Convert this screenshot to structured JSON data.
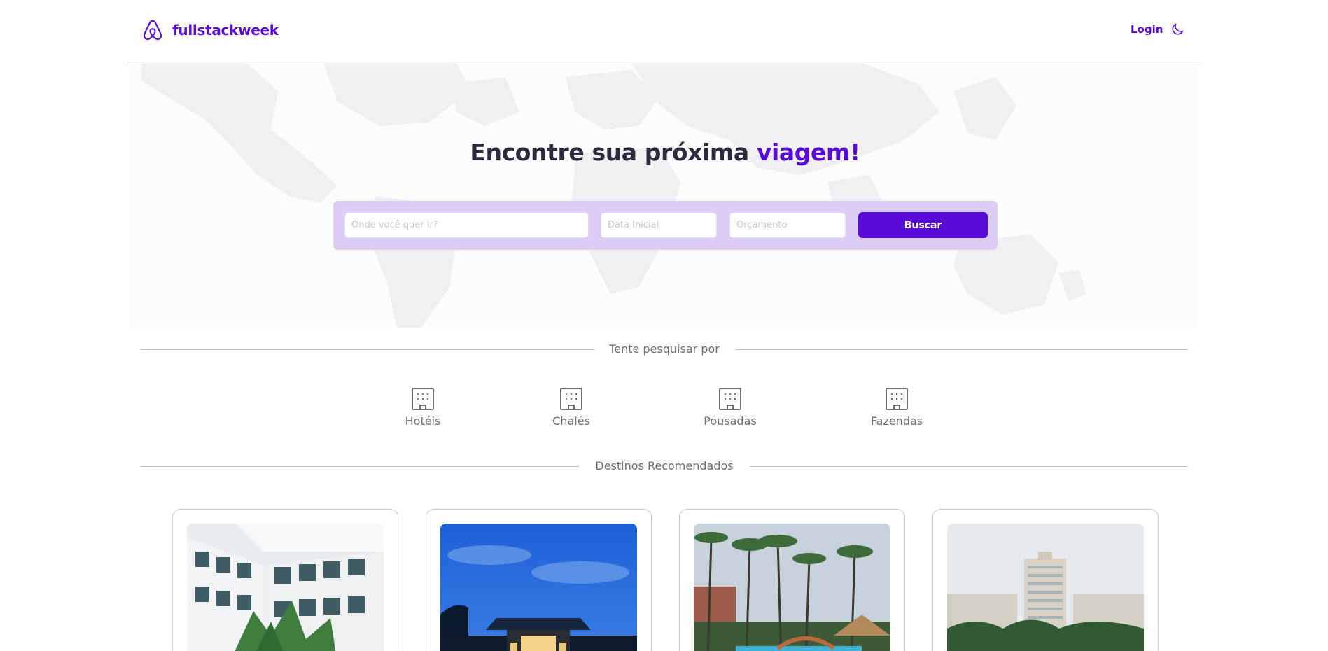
{
  "header": {
    "brand": "fullstackweek",
    "login_label": "Login",
    "brand_color": "#590bd8",
    "logo_icon": "airbnb-logo-icon",
    "theme_icon": "moon-icon"
  },
  "hero": {
    "title_prefix": "Encontre sua próxima ",
    "title_accent": "viagem!",
    "background": "world-map"
  },
  "search": {
    "where_placeholder": "Onde você quer ir?",
    "date_placeholder": "Data Inicial",
    "budget_placeholder": "Orçamento",
    "button_label": "Buscar"
  },
  "quick_search": {
    "heading": "Tente pesquisar por",
    "categories": [
      {
        "label": "Hotéis",
        "icon": "building-icon"
      },
      {
        "label": "Chalés",
        "icon": "building-icon"
      },
      {
        "label": "Pousadas",
        "icon": "building-icon"
      },
      {
        "label": "Fazendas",
        "icon": "building-icon"
      }
    ]
  },
  "recommended": {
    "heading": "Destinos Recomendados",
    "trips": [
      {
        "image": "white-hotel-balconies"
      },
      {
        "image": "resort-at-dusk"
      },
      {
        "image": "palm-pool-resort"
      },
      {
        "image": "tower-resort"
      }
    ]
  },
  "colors": {
    "accent": "#590bd8",
    "search_bar_bg": "#ddcdf6",
    "text_dark": "#2b2a3f",
    "text_muted": "#6d6d78"
  }
}
